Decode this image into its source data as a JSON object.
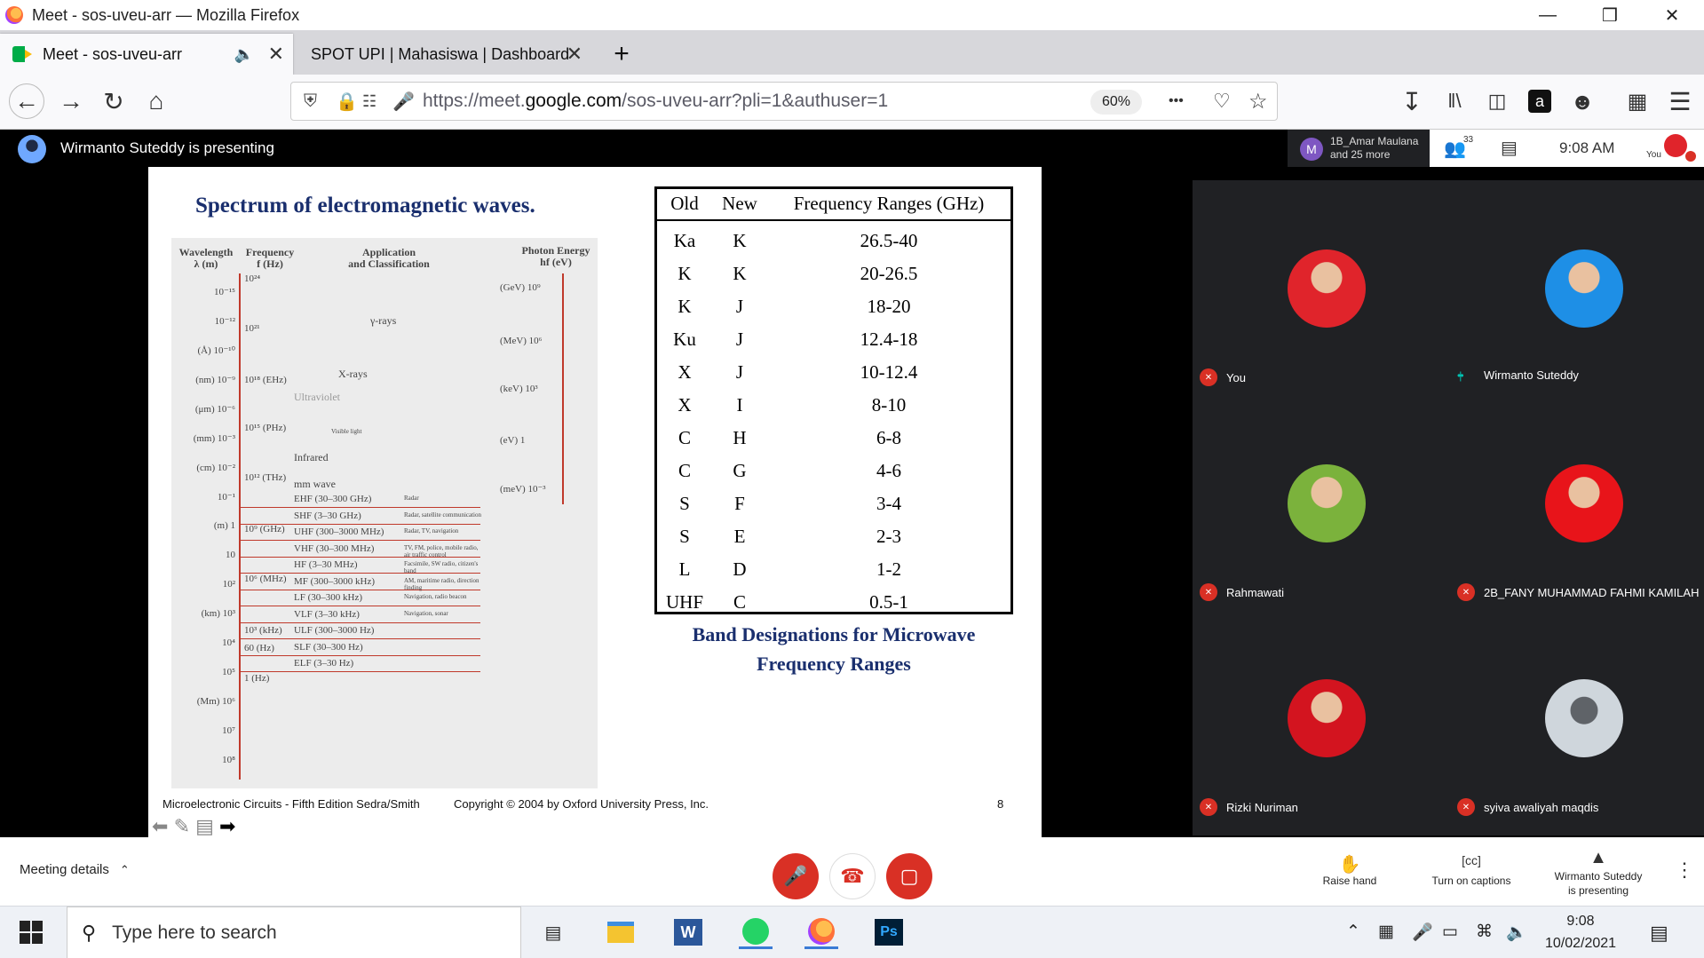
{
  "window": {
    "title": "Meet - sos-uveu-arr — Mozilla Firefox",
    "minimize": "—",
    "restore": "❒",
    "close": "✕"
  },
  "tabs": [
    {
      "label": "Meet - sos-uveu-arr",
      "audio_icon": "speaker-icon",
      "active": true
    },
    {
      "label": "SPOT UPI | Mahasiswa | Dashboard",
      "active": false
    }
  ],
  "tab_close": "✕",
  "new_tab": "+",
  "nav": {
    "url_prefix": "https://meet.",
    "url_domain": "google.com",
    "url_path": "/sos-uveu-arr?pli=1&authuser=1",
    "zoom": "60%",
    "more": "•••"
  },
  "meet": {
    "presenting": "Wirmanto Suteddy is presenting",
    "other_participant_line1": "1B_Amar Maulana",
    "other_participant_line2": "and 25 more",
    "participant_count": "33",
    "time": "9:08  AM",
    "self_label": "You"
  },
  "slide": {
    "title": "Spectrum of electromagnetic waves.",
    "scan": {
      "col_wavelength": "Wavelength",
      "col_wavelength_sym": "λ (m)",
      "col_frequency": "Frequency",
      "col_frequency_sym": "f (Hz)",
      "col_application": "Application",
      "col_application2": "and Classification",
      "col_photon": "Photon Energy",
      "col_photon_sym": "hf (eV)",
      "rows": [
        {
          "band": "EHF  (30–300 GHz)",
          "use": "Radar"
        },
        {
          "band": "SHF  (3–30 GHz)",
          "use": "Radar, satellite communication"
        },
        {
          "band": "UHF  (300–3000 MHz)",
          "use": "Radar, TV, navigation"
        },
        {
          "band": "VHF  (30–300 MHz)",
          "use": "TV, FM, police, mobile radio, air traffic control"
        },
        {
          "band": "HF  (3–30 MHz)",
          "use": "Facsimile, SW radio, citizen's band"
        },
        {
          "band": "MF  (300–3000 kHz)",
          "use": "AM, maritime radio, direction finding"
        },
        {
          "band": "LF  (30–300 kHz)",
          "use": "Navigation, radio beacon"
        },
        {
          "band": "VLF  (3–30 kHz)",
          "use": "Navigation, sonar"
        },
        {
          "band": "ULF  (300–3000 Hz)",
          "use": ""
        },
        {
          "band": "SLF  (30–300 Hz)",
          "use": ""
        },
        {
          "band": "ELF  (3–30 Hz)",
          "use": ""
        }
      ],
      "freq_labels": [
        "10²⁴",
        "10²¹",
        "10¹⁸ (EHz)",
        "10¹⁵ (PHz)",
        "10¹² (THz)",
        "10⁹ (GHz)",
        "10⁶ (MHz)",
        "10³ (kHz)",
        "60 (Hz)",
        "1 (Hz)"
      ],
      "wave_labels": [
        "10⁻¹⁵",
        "10⁻¹²",
        "(Å) 10⁻¹⁰",
        "(nm) 10⁻⁹",
        "(μm) 10⁻⁶",
        "(mm) 10⁻³",
        "(cm) 10⁻²",
        "10⁻¹",
        "(m) 1",
        "10",
        "10²",
        "(km) 10³",
        "10⁴",
        "10⁵",
        "(Mm) 10⁶",
        "10⁷",
        "10⁸"
      ],
      "photon_labels": [
        "(GeV) 10⁹",
        "(MeV) 10⁶",
        "(keV) 10³",
        "(eV) 1",
        "(meV) 10⁻³"
      ],
      "regions": [
        "γ-rays",
        "X-rays",
        "Ultraviolet",
        "Visible light",
        "Infrared",
        "mm wave"
      ]
    },
    "table": {
      "headers": [
        "Old",
        "New",
        "Frequency Ranges (GHz)"
      ],
      "rows": [
        [
          "Ka",
          "K",
          "26.5-40"
        ],
        [
          "K",
          "K",
          "20-26.5"
        ],
        [
          "K",
          "J",
          "18-20"
        ],
        [
          "Ku",
          "J",
          "12.4-18"
        ],
        [
          "X",
          "J",
          "10-12.4"
        ],
        [
          "X",
          "I",
          "8-10"
        ],
        [
          "C",
          "H",
          "6-8"
        ],
        [
          "C",
          "G",
          "4-6"
        ],
        [
          "S",
          "F",
          "3-4"
        ],
        [
          "S",
          "E",
          "2-3"
        ],
        [
          "L",
          "D",
          "1-2"
        ],
        [
          "UHF",
          "C",
          "0.5-1"
        ]
      ]
    },
    "caption_line1": "Band Designations for Microwave",
    "caption_line2": "Frequency Ranges",
    "footer_left": "Microelectronic Circuits - Fifth Edition    Sedra/Smith",
    "footer_center": "Copyright © 2004 by Oxford University Press, Inc.",
    "footer_page": "8"
  },
  "participants": [
    {
      "name": "You",
      "avatar_color": "#e0242b"
    },
    {
      "name": "Wirmanto Suteddy",
      "avatar_color": "#1e8fe6"
    },
    {
      "name": "Rahmawati",
      "avatar_color": "#7bb23c"
    },
    {
      "name": "2B_FANY MUHAMMAD FAHMI KAMILAH",
      "avatar_color": "#e8141a"
    },
    {
      "name": "Rizki Nuriman",
      "avatar_color": "#d3141f"
    },
    {
      "name": "syiva awaliyah maqdis",
      "avatar_color": "#cfd6dc"
    }
  ],
  "controls": {
    "meeting_details": "Meeting details",
    "raise_hand": "Raise hand",
    "captions": "Turn on captions",
    "presenting_line1": "Wirmanto Suteddy",
    "presenting_line2": "is presenting",
    "mic_color": "#d93025"
  },
  "taskbar": {
    "search_placeholder": "Type here to search",
    "time": "9:08",
    "date": "10/02/2021"
  }
}
